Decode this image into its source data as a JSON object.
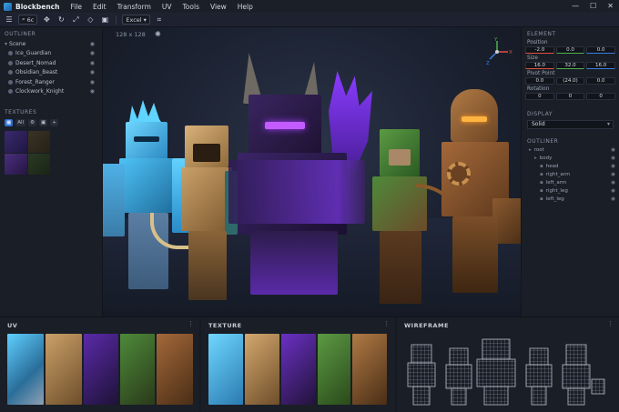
{
  "app": {
    "title": "Blockbench",
    "menu": [
      "File",
      "Edit",
      "Transform",
      "UV",
      "Tools",
      "View",
      "Help"
    ]
  },
  "toolbar": {
    "search_value": "6c",
    "mode_value": "Excel"
  },
  "outliner": {
    "heading": "OUTLINER",
    "root": "Scene",
    "items": [
      "Ice_Guardian",
      "Desert_Nomad",
      "Obsidian_Beast",
      "Forest_Ranger",
      "Clockwork_Knight"
    ]
  },
  "textures": {
    "heading": "TEXTURES",
    "tabs": [
      "All"
    ]
  },
  "viewport": {
    "resolution_label": "128 x 128"
  },
  "gizmo": {
    "x": "X",
    "y": "Y",
    "z": "Z"
  },
  "element": {
    "heading": "ELEMENT",
    "position_label": "Position",
    "position": [
      "-2.0",
      "0.0",
      "0.0"
    ],
    "size_label": "Size",
    "size": [
      "16.0",
      "32.0",
      "16.0"
    ],
    "pivot_label": "Pivot Point",
    "pivot": [
      "0.0",
      "(24.0)",
      "0.0"
    ],
    "rotation_label": "Rotation",
    "rotation": [
      "0",
      "0",
      "0"
    ]
  },
  "display": {
    "heading": "DISPLAY",
    "mode": "Solid"
  },
  "outliner_right": {
    "heading": "OUTLINER",
    "items": [
      "root",
      "body",
      "head",
      "right_arm",
      "left_arm",
      "right_leg",
      "left_leg"
    ]
  },
  "bottom": {
    "uv_heading": "UV",
    "texture_heading": "TEXTURE",
    "wireframe_heading": "WIREFRAME"
  },
  "colors": {
    "accent": "#2f6fd6",
    "ice": "#4fc3f7",
    "sand": "#c9a068",
    "obsidian": "#7b3fe0",
    "forest": "#4e8a3a",
    "bronze": "#a4683a"
  }
}
